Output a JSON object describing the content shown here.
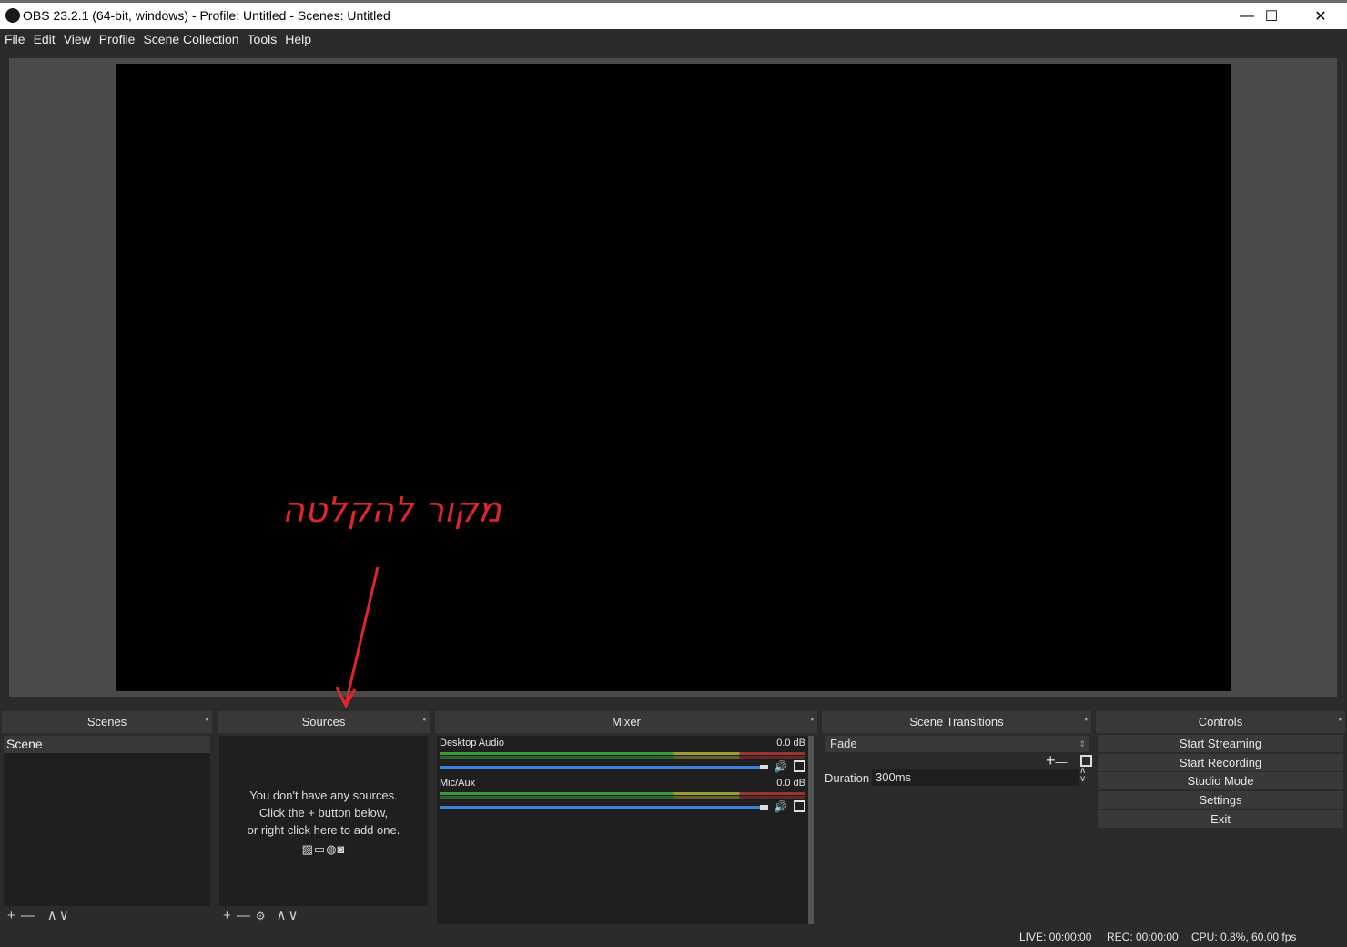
{
  "window": {
    "title": "OBS 23.2.1 (64-bit, windows) - Profile: Untitled - Scenes: Untitled",
    "minimize": "—",
    "maximize": "☐",
    "close": "✕"
  },
  "menu": [
    "File",
    "Edit",
    "View",
    "Profile",
    "Scene Collection",
    "Tools",
    "Help"
  ],
  "annotation": {
    "text": "מקור להקלטה",
    "color": "#e0262c"
  },
  "docks": {
    "scenes": {
      "title": "Scenes",
      "items": [
        "Scene"
      ],
      "toolbar": [
        "+",
        "—",
        "∧",
        "∨"
      ]
    },
    "sources": {
      "title": "Sources",
      "empty_line1": "You don't have any sources.",
      "empty_line2": "Click the + button below,",
      "empty_line3": "or right click here to add one.",
      "toolbar": [
        "+",
        "—",
        "⚙",
        "∧",
        "∨"
      ]
    },
    "mixer": {
      "title": "Mixer",
      "channels": [
        {
          "name": "Desktop Audio",
          "db": "0.0 dB"
        },
        {
          "name": "Mic/Aux",
          "db": "0.0 dB"
        }
      ]
    },
    "transitions": {
      "title": "Scene Transitions",
      "selected": "Fade",
      "add": "+",
      "remove": "—",
      "duration_label": "Duration",
      "duration_value": "300ms"
    },
    "controls": {
      "title": "Controls",
      "buttons": [
        "Start Streaming",
        "Start Recording",
        "Studio Mode",
        "Settings",
        "Exit"
      ]
    }
  },
  "status": {
    "live": "LIVE: 00:00:00",
    "rec": "REC: 00:00:00",
    "cpu": "CPU: 0.8%, 60.00 fps"
  }
}
